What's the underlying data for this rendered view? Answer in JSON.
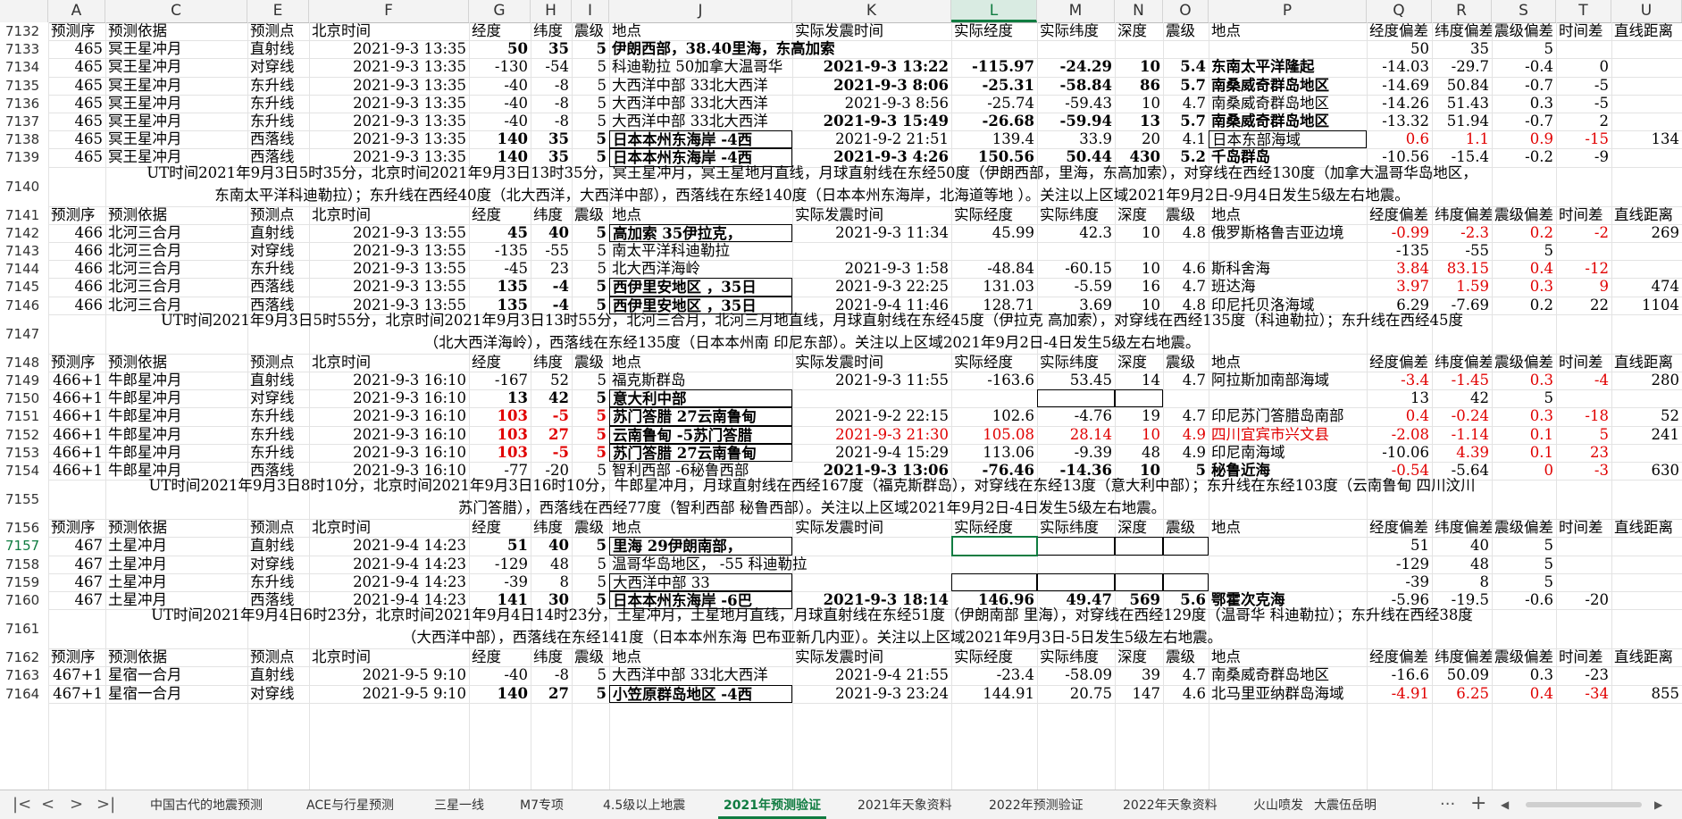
{
  "columns": [
    "",
    "A",
    "C",
    "E",
    "F",
    "G",
    "H",
    "I",
    "J",
    "K",
    "L",
    "M",
    "N",
    "O",
    "P",
    "Q",
    "R",
    "S",
    "T",
    "U"
  ],
  "selected_column": "L",
  "selected_row": "7157",
  "header_labels": [
    "预测序",
    "预测依据",
    "预测点",
    "北京时间",
    "经度",
    "纬度",
    "震级",
    "地点",
    "实际发震时间",
    "实际经度",
    "实际纬度",
    "深度",
    "震级",
    "地点",
    "经度偏差",
    "纬度偏差",
    "震级偏差",
    "时间差",
    "直线距离"
  ],
  "rows": [
    {
      "n": "7132",
      "t": "head"
    },
    {
      "n": "7133",
      "A": "465",
      "C": "冥王星冲月",
      "E": "直射线",
      "F": "2021-9-3 13:35",
      "G": "50",
      "H": "35",
      "I": "5",
      "J": "伊朗西部，38.40里海，东高加索",
      "Q": "50",
      "R": "35",
      "S": "5",
      "bG": 1,
      "bH": 1,
      "bI": 1,
      "bJ": 1,
      "wideJ": 1
    },
    {
      "n": "7134",
      "A": "465",
      "C": "冥王星冲月",
      "E": "对穿线",
      "F": "2021-9-3 13:35",
      "G": "-130",
      "H": "-54",
      "I": "5",
      "J": "科迪勒拉  50加拿大温哥华",
      "K": "2021-9-3 13:22",
      "L": "-115.97",
      "M": "-24.29",
      "N": "10",
      "O": "5.4",
      "P": "东南太平洋隆起",
      "Q": "-14.03",
      "R": "-29.7",
      "S": "-0.4",
      "T": "0",
      "bK": 1,
      "bL": 1,
      "bM": 1,
      "bN": 1,
      "bO": 1,
      "bP": 1
    },
    {
      "n": "7135",
      "A": "465",
      "C": "冥王星冲月",
      "E": "东升线",
      "F": "2021-9-3 13:35",
      "G": "-40",
      "H": "-8",
      "I": "5",
      "J": "大西洋中部 33北大西洋",
      "K": "2021-9-3 8:06",
      "L": "-25.31",
      "M": "-58.84",
      "N": "86",
      "O": "5.7",
      "P": "南桑威奇群岛地区",
      "Q": "-14.69",
      "R": "50.84",
      "S": "-0.7",
      "T": "-5",
      "bK": 1,
      "bL": 1,
      "bM": 1,
      "bN": 1,
      "bO": 1,
      "bP": 1
    },
    {
      "n": "7136",
      "A": "465",
      "C": "冥王星冲月",
      "E": "东升线",
      "F": "2021-9-3 13:35",
      "G": "-40",
      "H": "-8",
      "I": "5",
      "J": "大西洋中部 33北大西洋",
      "K": "2021-9-3 8:56",
      "L": "-25.74",
      "M": "-59.43",
      "N": "10",
      "O": "4.7",
      "P": "南桑威奇群岛地区",
      "Q": "-14.26",
      "R": "51.43",
      "S": "0.3",
      "T": "-5"
    },
    {
      "n": "7137",
      "A": "465",
      "C": "冥王星冲月",
      "E": "东升线",
      "F": "2021-9-3 13:35",
      "G": "-40",
      "H": "-8",
      "I": "5",
      "J": "大西洋中部 33北大西洋",
      "K": "2021-9-3 15:49",
      "L": "-26.68",
      "M": "-59.94",
      "N": "13",
      "O": "5.7",
      "P": "南桑威奇群岛地区",
      "Q": "-13.32",
      "R": "51.94",
      "S": "-0.7",
      "T": "2",
      "bK": 1,
      "bL": 1,
      "bM": 1,
      "bN": 1,
      "bO": 1,
      "bP": 1
    },
    {
      "n": "7138",
      "A": "465",
      "C": "冥王星冲月",
      "E": "西落线",
      "F": "2021-9-3 13:35",
      "G": "140",
      "H": "35",
      "I": "5",
      "J": "日本本州东海岸 -4西",
      "K": "2021-9-2 21:51",
      "L": "139.4",
      "M": "33.9",
      "N": "20",
      "O": "4.1",
      "P": "日本东部海域",
      "Q": "0.6",
      "R": "1.1",
      "S": "0.9",
      "T": "-15",
      "U": "134",
      "bG": 1,
      "bH": 1,
      "bI": 1,
      "bJ": 1,
      "boxJ": 1,
      "boxP": 1,
      "redQ": 1,
      "redR": 1,
      "redS": 1,
      "redT": 1
    },
    {
      "n": "7139",
      "A": "465",
      "C": "冥王星冲月",
      "E": "西落线",
      "F": "2021-9-3 13:35",
      "G": "140",
      "H": "35",
      "I": "5",
      "J": "日本本州东海岸 -4西",
      "K": "2021-9-3 4:26",
      "L": "150.56",
      "M": "50.44",
      "N": "430",
      "O": "5.2",
      "P": "千岛群岛",
      "Q": "-10.56",
      "R": "-15.4",
      "S": "-0.2",
      "T": "-9",
      "bG": 1,
      "bH": 1,
      "bI": 1,
      "bJ": 1,
      "boxJ": 1,
      "bK": 1,
      "bL": 1,
      "bM": 1,
      "bN": 1,
      "bO": 1,
      "bP": 1
    },
    {
      "n": "7140",
      "t": "note",
      "lines": [
        "UT时间2021年9月3日5时35分，北京时间2021年9月3日13时35分，冥王星冲月，冥王星地月直线，月球直射线在东经50度（伊朗西部，里海，东高加索），对穿线在西经130度（加拿大温哥华岛地区，",
        "东南太平洋科迪勒拉）；东升线在西经40度（北大西洋，大西洋中部），西落线在东经140度（日本本州东海岸，北海道等地 ）。关注以上区域2021年9月2日-9月4日发生5级左右地震。"
      ]
    },
    {
      "n": "7141",
      "t": "head"
    },
    {
      "n": "7142",
      "A": "466",
      "C": "北河三合月",
      "E": "直射线",
      "F": "2021-9-3 13:55",
      "G": "45",
      "H": "40",
      "I": "5",
      "J": "高加索 35伊拉克，",
      "K": "2021-9-3 11:34",
      "L": "45.99",
      "M": "42.3",
      "N": "10",
      "O": "4.8",
      "P": "俄罗斯格鲁吉亚边境",
      "Q": "-0.99",
      "R": "-2.3",
      "S": "0.2",
      "T": "-2",
      "U": "269",
      "bG": 1,
      "bH": 1,
      "bI": 1,
      "bJ": 1,
      "boxJ": 1,
      "redQ": 1,
      "redR": 1,
      "redS": 1,
      "redT": 1
    },
    {
      "n": "7143",
      "A": "466",
      "C": "北河三合月",
      "E": "对穿线",
      "F": "2021-9-3 13:55",
      "G": "-135",
      "H": "-55",
      "I": "5",
      "J": "南太平洋科迪勒拉",
      "Q": "-135",
      "R": "-55",
      "S": "5"
    },
    {
      "n": "7144",
      "A": "466",
      "C": "北河三合月",
      "E": "东升线",
      "F": "2021-9-3 13:55",
      "G": "-45",
      "H": "23",
      "I": "5",
      "J": "北大西洋海岭",
      "K": "2021-9-3 1:58",
      "L": "-48.84",
      "M": "-60.15",
      "N": "10",
      "O": "4.6",
      "P": "斯科舍海",
      "Q": "3.84",
      "R": "83.15",
      "S": "0.4",
      "T": "-12",
      "redQ": 1,
      "redR": 1,
      "redS": 1,
      "redT": 1
    },
    {
      "n": "7145",
      "A": "466",
      "C": "北河三合月",
      "E": "西落线",
      "F": "2021-9-3 13:55",
      "G": "135",
      "H": "-4",
      "I": "5",
      "J": "西伊里安地区 ，35日",
      "K": "2021-9-3 22:25",
      "L": "131.03",
      "M": "-5.59",
      "N": "16",
      "O": "4.7",
      "P": "班达海",
      "Q": "3.97",
      "R": "1.59",
      "S": "0.3",
      "T": "9",
      "U": "474",
      "bG": 1,
      "bH": 1,
      "bI": 1,
      "bJ": 1,
      "boxJ": 1,
      "redQ": 1,
      "redR": 1,
      "redS": 1,
      "redT": 1
    },
    {
      "n": "7146",
      "A": "466",
      "C": "北河三合月",
      "E": "西落线",
      "F": "2021-9-3 13:55",
      "G": "135",
      "H": "-4",
      "I": "5",
      "J": "西伊里安地区 ，35日",
      "K": "2021-9-4 11:46",
      "L": "128.71",
      "M": "3.69",
      "N": "10",
      "O": "4.8",
      "P": "印尼托贝洛海域",
      "Q": "6.29",
      "R": "-7.69",
      "S": "0.2",
      "T": "22",
      "U": "1104",
      "bG": 1,
      "bH": 1,
      "bI": 1,
      "bJ": 1,
      "boxJ": 1
    },
    {
      "n": "7147",
      "t": "note",
      "lines": [
        "UT时间2021年9月3日5时55分，北京时间2021年9月3日13时55分，北河三合月，北河三月地直线，月球直射线在东经45度（伊拉克 高加索），对穿线在西经135度（科迪勒拉）；东升线在西经45度",
        "（北大西洋海岭），西落线在东经135度（日本本州南 印尼东部）。关注以上区域2021年9月2日-4日发生5级左右地震。"
      ]
    },
    {
      "n": "7148",
      "t": "head"
    },
    {
      "n": "7149",
      "A": "466+1",
      "C": "牛郎星冲月",
      "E": "直射线",
      "F": "2021-9-3 16:10",
      "G": "-167",
      "H": "52",
      "I": "5",
      "J": "福克斯群岛",
      "K": "2021-9-3 11:55",
      "L": "-163.6",
      "M": "53.45",
      "N": "14",
      "O": "4.7",
      "P": "阿拉斯加南部海域",
      "Q": "-3.4",
      "R": "-1.45",
      "S": "0.3",
      "T": "-4",
      "U": "280",
      "redQ": 1,
      "redR": 1,
      "redS": 1,
      "redT": 1
    },
    {
      "n": "7150",
      "A": "466+1",
      "C": "牛郎星冲月",
      "E": "对穿线",
      "F": "2021-9-3 16:10",
      "G": "13",
      "H": "42",
      "I": "5",
      "J": "意大利中部",
      "Q": "13",
      "R": "42",
      "S": "5",
      "bG": 1,
      "bH": 1,
      "bI": 1,
      "bJ": 1,
      "boxJ": 1,
      "boxM": 1,
      "boxN": 1
    },
    {
      "n": "7151",
      "A": "466+1",
      "C": "牛郎星冲月",
      "E": "东升线",
      "F": "2021-9-3 16:10",
      "G": "103",
      "H": "-5",
      "I": "5",
      "J": "苏门答腊 27云南鲁甸",
      "K": "2021-9-2 22:15",
      "L": "102.6",
      "M": "-4.76",
      "N": "19",
      "O": "4.7",
      "P": "印尼苏门答腊岛南部",
      "Q": "0.4",
      "R": "-0.24",
      "S": "0.3",
      "T": "-18",
      "U": "52",
      "bG": 1,
      "bH": 1,
      "bI": 1,
      "bJ": 1,
      "boxJ": 1,
      "redG": 1,
      "redH": 1,
      "redI": 1,
      "redQ": 1,
      "redR": 1,
      "redS": 1,
      "redT": 1
    },
    {
      "n": "7152",
      "A": "466+1",
      "C": "牛郎星冲月",
      "E": "东升线",
      "F": "2021-9-3 16:10",
      "G": "103",
      "H": "27",
      "I": "5",
      "J": "云南鲁甸 -5苏门答腊",
      "K": "2021-9-3 21:30",
      "L": "105.08",
      "M": "28.14",
      "N": "10",
      "O": "4.9",
      "P": "四川宜宾市兴文县",
      "Q": "-2.08",
      "R": "-1.14",
      "S": "0.1",
      "T": "5",
      "U": "241",
      "bG": 1,
      "bH": 1,
      "bI": 1,
      "bJ": 1,
      "boxJ": 1,
      "redG": 1,
      "redH": 1,
      "redI": 1,
      "redK": 1,
      "redL": 1,
      "redM": 1,
      "redN": 1,
      "redO": 1,
      "redP": 1,
      "redQ": 1,
      "redR": 1,
      "redS": 1,
      "redT": 1
    },
    {
      "n": "7153",
      "A": "466+1",
      "C": "牛郎星冲月",
      "E": "东升线",
      "F": "2021-9-3 16:10",
      "G": "103",
      "H": "-5",
      "I": "5",
      "J": "苏门答腊 27云南鲁甸",
      "K": "2021-9-4 15:29",
      "L": "113.06",
      "M": "-9.39",
      "N": "48",
      "O": "4.9",
      "P": "印尼南海域",
      "Q": "-10.06",
      "R": "4.39",
      "S": "0.1",
      "T": "23",
      "bG": 1,
      "bH": 1,
      "bI": 1,
      "bJ": 1,
      "boxJ": 1,
      "redG": 1,
      "redH": 1,
      "redI": 1,
      "redR": 1,
      "redS": 1,
      "redT": 1
    },
    {
      "n": "7154",
      "A": "466+1",
      "C": "牛郎星冲月",
      "E": "西落线",
      "F": "2021-9-3 16:10",
      "G": "-77",
      "H": "-20",
      "I": "5",
      "J": "智利西部 -6秘鲁西部",
      "K": "2021-9-3 13:06",
      "L": "-76.46",
      "M": "-14.36",
      "N": "10",
      "O": "5",
      "P": "秘鲁近海",
      "Q": "-0.54",
      "R": "-5.64",
      "S": "0",
      "T": "-3",
      "U": "630",
      "bK": 1,
      "bL": 1,
      "bM": 1,
      "bN": 1,
      "bO": 1,
      "bP": 1,
      "redQ": 1,
      "redS": 1,
      "redT": 1
    },
    {
      "n": "7155",
      "t": "note",
      "lines": [
        "UT时间2021年9月3日8时10分，北京时间2021年9月3日16时10分，牛郎星冲月，月球直射线在西经167度（福克斯群岛），对穿线在东经13度（意大利中部）；东升线在东经103度（云南鲁甸 四川汶川",
        "苏门答腊），西落线在西经77度（智利西部 秘鲁西部）。关注以上区域2021年9月2日-4日发生5级左右地震。"
      ]
    },
    {
      "n": "7156",
      "t": "head"
    },
    {
      "n": "7157",
      "A": "467",
      "C": "土星冲月",
      "E": "直射线",
      "F": "2021-9-4 14:23",
      "G": "51",
      "H": "40",
      "I": "5",
      "J": "里海 29伊朗南部，",
      "Q": "51",
      "R": "40",
      "S": "5",
      "bG": 1,
      "bH": 1,
      "bI": 1,
      "bJ": 1,
      "boxJ": 1,
      "boxL": 1,
      "boxM": 1,
      "boxN": 1,
      "boxO": 1
    },
    {
      "n": "7158",
      "A": "467",
      "C": "土星冲月",
      "E": "对穿线",
      "F": "2021-9-4 14:23",
      "G": "-129",
      "H": "48",
      "I": "5",
      "J": "温哥华岛地区， -55 科迪勒拉",
      "Q": "-129",
      "R": "48",
      "S": "5",
      "wideJ": 1
    },
    {
      "n": "7159",
      "A": "467",
      "C": "土星冲月",
      "E": "东升线",
      "F": "2021-9-4 14:23",
      "G": "-39",
      "H": "8",
      "I": "5",
      "J": "大西洋中部 33",
      "Q": "-39",
      "R": "8",
      "S": "5",
      "boxJ": 1,
      "boxL": 1,
      "boxM": 1,
      "boxN": 1,
      "boxO": 1
    },
    {
      "n": "7160",
      "A": "467",
      "C": "土星冲月",
      "E": "西落线",
      "F": "2021-9-4 14:23",
      "G": "141",
      "H": "30",
      "I": "5",
      "J": "日本本州东海岸 -6巴",
      "K": "2021-9-3 18:14",
      "L": "146.96",
      "M": "49.47",
      "N": "569",
      "O": "5.6",
      "P": "鄂霍次克海",
      "Q": "-5.96",
      "R": "-19.5",
      "S": "-0.6",
      "T": "-20",
      "bG": 1,
      "bH": 1,
      "bI": 1,
      "bJ": 1,
      "boxJ": 1,
      "bK": 1,
      "bL": 1,
      "bM": 1,
      "bN": 1,
      "bO": 1,
      "bP": 1
    },
    {
      "n": "7161",
      "t": "note",
      "lines": [
        "UT时间2021年9月4日6时23分，北京时间2021年9月4日14时23分，土星冲月，土星地月直线，月球直射线在东经51度（伊朗南部 里海），对穿线在西经129度（温哥华 科迪勒拉）；东升线在西经38度",
        "（大西洋中部），西落线在东经141度（日本本州东海 巴布亚新几内亚）。关注以上区域2021年9月3日-5日发生5级左右地震。"
      ]
    },
    {
      "n": "7162",
      "t": "head"
    },
    {
      "n": "7163",
      "A": "467+1",
      "C": "星宿一合月",
      "E": "直射线",
      "F": "2021-9-5 9:10",
      "G": "-40",
      "H": "-8",
      "I": "5",
      "J": "大西洋中部 33北大西洋",
      "K": "2021-9-4 21:55",
      "L": "-23.4",
      "M": "-58.09",
      "N": "39",
      "O": "4.7",
      "P": "南桑威奇群岛地区",
      "Q": "-16.6",
      "R": "50.09",
      "S": "0.3",
      "T": "-23"
    },
    {
      "n": "7164",
      "A": "467+1",
      "C": "星宿一合月",
      "E": "对穿线",
      "F": "2021-9-5 9:10",
      "G": "140",
      "H": "27",
      "I": "5",
      "J": "小笠原群岛地区 -4西",
      "K": "2021-9-3 23:24",
      "L": "144.91",
      "M": "20.75",
      "N": "147",
      "O": "4.6",
      "P": "北马里亚纳群岛海域",
      "Q": "-4.91",
      "R": "6.25",
      "S": "0.4",
      "T": "-34",
      "U": "855",
      "bG": 1,
      "bH": 1,
      "bI": 1,
      "bJ": 1,
      "boxJ": 1,
      "redQ": 1,
      "redR": 1,
      "redS": 1,
      "redT": 1
    }
  ],
  "tabs": [
    "中国古代的地震预测",
    "ACE与行星预测",
    "三星一线",
    "M7专项",
    "4.5级以上地震",
    "2021年预测验证",
    "2021年天象资料",
    "2022年预测验证",
    "2022年天象资料",
    "火山喷发",
    "大震伍岳明"
  ],
  "active_tab": "2021年预测验证",
  "nav": {
    "first": "|<",
    "prev": "<",
    "next": ">",
    "last": ">|",
    "more": "···",
    "add": "+"
  },
  "colors": {
    "accent": "#107c41",
    "red": "#e00000",
    "grid": "#e3e3e3"
  }
}
